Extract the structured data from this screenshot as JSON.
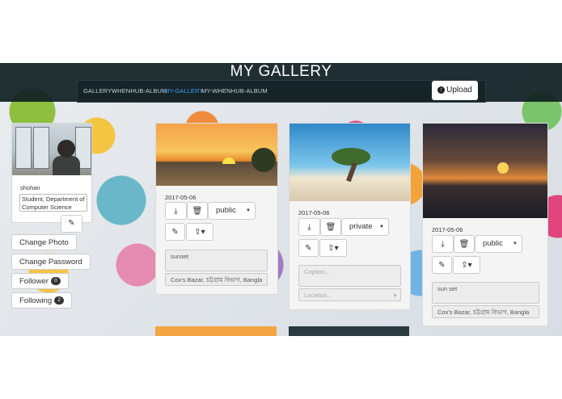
{
  "header": {
    "title": "MY GALLERY"
  },
  "nav": {
    "items": [
      {
        "label": "GALLERY"
      },
      {
        "label": "WHENHUB-ALBUM"
      },
      {
        "label": "MY-GALLERY"
      },
      {
        "label": "MY-WHENHUB-ALBUM"
      }
    ],
    "active": "MY-GALLERY",
    "upload_label": "Upload"
  },
  "profile": {
    "username": "shohan",
    "bio": "Student, Department of Computer Science"
  },
  "sidebar": {
    "change_photo": "Change Photo",
    "change_password": "Change Password",
    "follower_label": "Follower",
    "follower_count": "0",
    "following_label": "Following",
    "following_count": "2"
  },
  "cards": [
    {
      "date": "2017-05-06",
      "privacy": "public",
      "caption": "sunset",
      "caption_placeholder": "Caption...",
      "location": "Cox's Bazar, চট্টগ্রাম বিভাগ, Bangla",
      "location_placeholder": "Location..."
    },
    {
      "date": "2017-05-06",
      "privacy": "private",
      "caption": "",
      "caption_placeholder": "Caption...",
      "location": "",
      "location_placeholder": "Location..."
    },
    {
      "date": "2017-05-06",
      "privacy": "public",
      "caption": "sun set",
      "caption_placeholder": "Caption...",
      "location": "Cox's Bazar, চট্টগ্রাম বিভাগ, Bangla",
      "location_placeholder": "Location..."
    }
  ],
  "colors": {
    "nav_active": "#3d9be9",
    "header_bg": "#0e1e22"
  },
  "icons": [
    "download-icon",
    "trash-icon",
    "pencil-icon",
    "share-icon",
    "upload-icon",
    "map-pin-icon"
  ]
}
